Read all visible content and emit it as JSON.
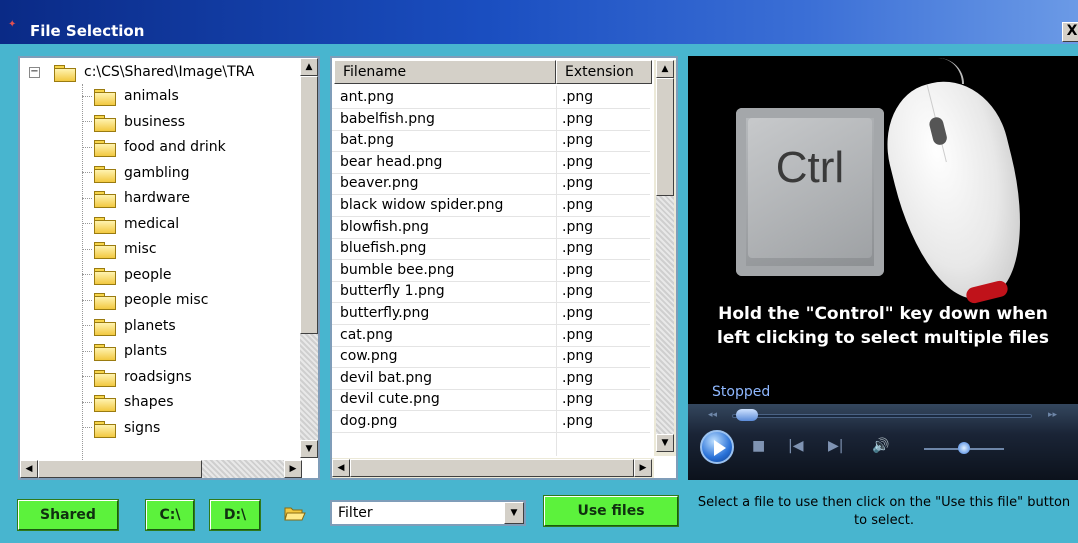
{
  "window": {
    "title": "File Selection",
    "close_label": "X"
  },
  "tree": {
    "root": "c:\\CS\\Shared\\Image\\TRA",
    "folders": [
      "animals",
      "business",
      "food and drink",
      "gambling",
      "hardware",
      "medical",
      "misc",
      "people",
      "people misc",
      "planets",
      "plants",
      "roadsigns",
      "shapes",
      "signs"
    ]
  },
  "file_list": {
    "columns": [
      "Filename",
      "Extension"
    ],
    "rows": [
      [
        "ant.png",
        ".png"
      ],
      [
        "babelfish.png",
        ".png"
      ],
      [
        "bat.png",
        ".png"
      ],
      [
        "bear head.png",
        ".png"
      ],
      [
        "beaver.png",
        ".png"
      ],
      [
        "black widow spider.png",
        ".png"
      ],
      [
        "blowfish.png",
        ".png"
      ],
      [
        "bluefish.png",
        ".png"
      ],
      [
        "bumble bee.png",
        ".png"
      ],
      [
        "butterfly 1.png",
        ".png"
      ],
      [
        "butterfly.png",
        ".png"
      ],
      [
        "cat.png",
        ".png"
      ],
      [
        "cow.png",
        ".png"
      ],
      [
        "devil bat.png",
        ".png"
      ],
      [
        "devil cute.png",
        ".png"
      ],
      [
        "dog.png",
        ".png"
      ]
    ]
  },
  "preview": {
    "key_label": "Ctrl",
    "caption_line1": "Hold the \"Control\" key down when",
    "caption_line2": "left clicking to select multiple files",
    "status": "Stopped"
  },
  "buttons": {
    "shared": "Shared",
    "c_drive": "C:\\",
    "d_drive": "D:\\",
    "use_files": "Use files"
  },
  "filter": {
    "value": "Filter"
  },
  "help_text": "Select a file to use then click on the \"Use this file\" button to select."
}
